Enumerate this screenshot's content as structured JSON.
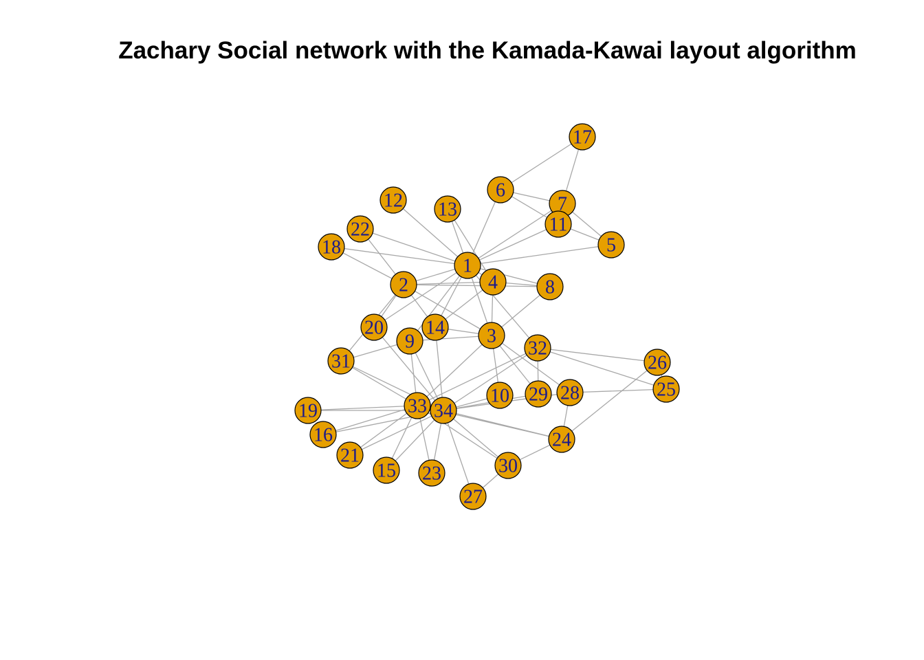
{
  "title": "Zachary Social network with the Kamada-Kawai layout algorithm",
  "colors": {
    "node_fill": "#E69F00",
    "node_stroke": "#000000",
    "label": "#1a1a8c",
    "edge": "#a8a8a8"
  },
  "nodes": [
    "1",
    "2",
    "3",
    "4",
    "5",
    "6",
    "7",
    "8",
    "9",
    "10",
    "11",
    "12",
    "13",
    "14",
    "15",
    "16",
    "17",
    "18",
    "19",
    "20",
    "21",
    "22",
    "23",
    "24",
    "25",
    "26",
    "27",
    "28",
    "29",
    "30",
    "31",
    "32",
    "33",
    "34"
  ],
  "edges": [
    [
      "1",
      "2"
    ],
    [
      "1",
      "3"
    ],
    [
      "1",
      "4"
    ],
    [
      "1",
      "5"
    ],
    [
      "1",
      "6"
    ],
    [
      "1",
      "7"
    ],
    [
      "1",
      "8"
    ],
    [
      "1",
      "9"
    ],
    [
      "1",
      "11"
    ],
    [
      "1",
      "12"
    ],
    [
      "1",
      "13"
    ],
    [
      "1",
      "14"
    ],
    [
      "1",
      "18"
    ],
    [
      "1",
      "20"
    ],
    [
      "1",
      "22"
    ],
    [
      "1",
      "32"
    ],
    [
      "2",
      "3"
    ],
    [
      "2",
      "4"
    ],
    [
      "2",
      "8"
    ],
    [
      "2",
      "14"
    ],
    [
      "2",
      "18"
    ],
    [
      "2",
      "20"
    ],
    [
      "2",
      "22"
    ],
    [
      "2",
      "31"
    ],
    [
      "3",
      "4"
    ],
    [
      "3",
      "8"
    ],
    [
      "3",
      "9"
    ],
    [
      "3",
      "10"
    ],
    [
      "3",
      "14"
    ],
    [
      "3",
      "28"
    ],
    [
      "3",
      "29"
    ],
    [
      "3",
      "33"
    ],
    [
      "4",
      "8"
    ],
    [
      "4",
      "13"
    ],
    [
      "4",
      "14"
    ],
    [
      "5",
      "7"
    ],
    [
      "5",
      "11"
    ],
    [
      "6",
      "7"
    ],
    [
      "6",
      "11"
    ],
    [
      "6",
      "17"
    ],
    [
      "7",
      "17"
    ],
    [
      "9",
      "31"
    ],
    [
      "9",
      "33"
    ],
    [
      "9",
      "34"
    ],
    [
      "10",
      "34"
    ],
    [
      "14",
      "34"
    ],
    [
      "15",
      "33"
    ],
    [
      "15",
      "34"
    ],
    [
      "16",
      "33"
    ],
    [
      "16",
      "34"
    ],
    [
      "19",
      "33"
    ],
    [
      "19",
      "34"
    ],
    [
      "20",
      "34"
    ],
    [
      "21",
      "33"
    ],
    [
      "21",
      "34"
    ],
    [
      "23",
      "33"
    ],
    [
      "23",
      "34"
    ],
    [
      "24",
      "26"
    ],
    [
      "24",
      "28"
    ],
    [
      "24",
      "30"
    ],
    [
      "24",
      "33"
    ],
    [
      "24",
      "34"
    ],
    [
      "25",
      "26"
    ],
    [
      "25",
      "28"
    ],
    [
      "25",
      "32"
    ],
    [
      "26",
      "32"
    ],
    [
      "27",
      "30"
    ],
    [
      "27",
      "34"
    ],
    [
      "28",
      "34"
    ],
    [
      "29",
      "32"
    ],
    [
      "29",
      "34"
    ],
    [
      "30",
      "33"
    ],
    [
      "30",
      "34"
    ],
    [
      "31",
      "33"
    ],
    [
      "31",
      "34"
    ],
    [
      "32",
      "33"
    ],
    [
      "32",
      "34"
    ],
    [
      "33",
      "34"
    ]
  ]
}
